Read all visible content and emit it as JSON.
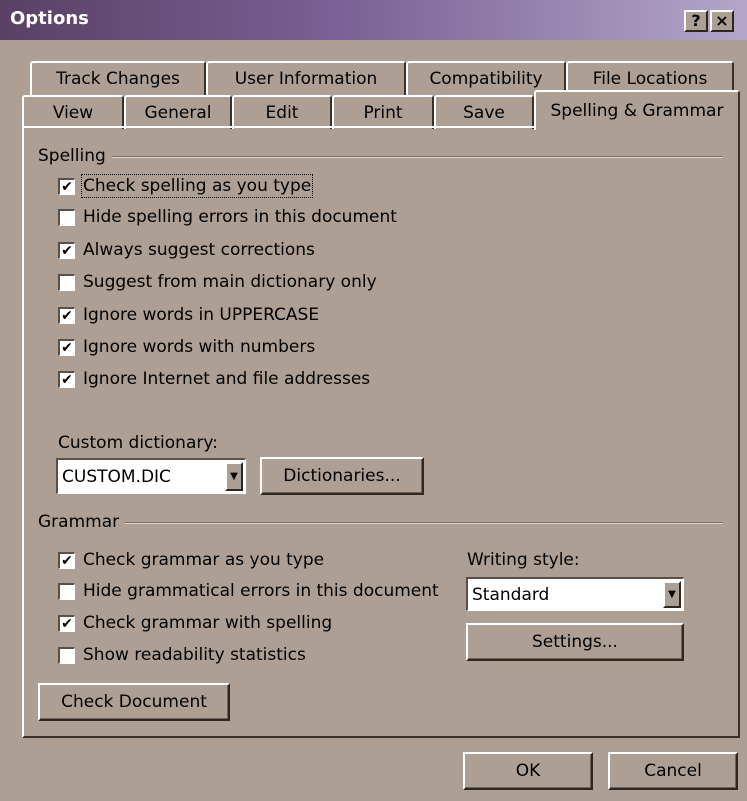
{
  "window": {
    "title": "Options",
    "help_glyph": "?",
    "close_glyph": "×"
  },
  "tabs_back": [
    "Track Changes",
    "User Information",
    "Compatibility",
    "File Locations"
  ],
  "tabs_front": [
    "View",
    "General",
    "Edit",
    "Print",
    "Save",
    "Spelling & Grammar"
  ],
  "spelling": {
    "label": "Spelling",
    "options": [
      {
        "label": "Check spelling as you type",
        "checked": true
      },
      {
        "label": "Hide spelling errors in this document",
        "checked": false
      },
      {
        "label": "Always suggest corrections",
        "checked": true
      },
      {
        "label": "Suggest from main dictionary only",
        "checked": false
      },
      {
        "label": "Ignore words in UPPERCASE",
        "checked": true
      },
      {
        "label": "Ignore words with numbers",
        "checked": true
      },
      {
        "label": "Ignore Internet and file addresses",
        "checked": true
      }
    ],
    "custom_dictionary_label": "Custom dictionary:",
    "custom_dictionary_value": "CUSTOM.DIC",
    "dictionaries_button": "Dictionaries..."
  },
  "grammar": {
    "label": "Grammar",
    "options": [
      {
        "label": "Check grammar as you type",
        "checked": true
      },
      {
        "label": "Hide grammatical errors in this document",
        "checked": false
      },
      {
        "label": "Check grammar with spelling",
        "checked": true
      },
      {
        "label": "Show readability statistics",
        "checked": false
      }
    ],
    "writing_style_label": "Writing style:",
    "writing_style_value": "Standard",
    "settings_button": "Settings...",
    "check_document_button": "Check Document"
  },
  "footer": {
    "ok": "OK",
    "cancel": "Cancel"
  },
  "icons": {
    "check": "✔",
    "dropdown": "▼"
  },
  "colors": {
    "face": "#ae9f94",
    "title_start": "#5a4064",
    "title_end": "#b3a6c9"
  }
}
